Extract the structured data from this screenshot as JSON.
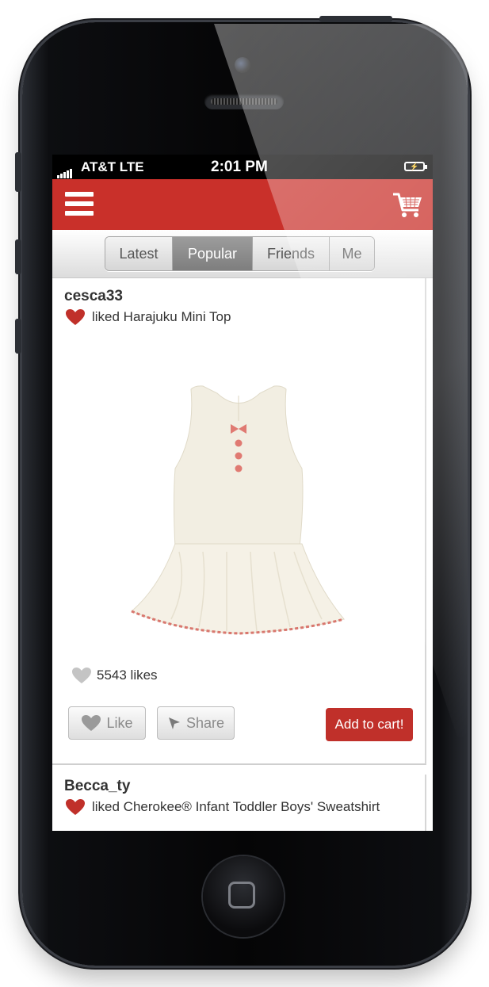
{
  "status_bar": {
    "carrier": "AT&T  LTE",
    "time": "2:01 PM"
  },
  "header": {
    "menu_icon": "hamburger-menu-icon",
    "cart_icon": "shopping-cart-icon",
    "brand_color": "#c9302a"
  },
  "tabs": [
    {
      "label": "Latest",
      "active": false
    },
    {
      "label": "Popular",
      "active": true
    },
    {
      "label": "Friends",
      "active": false
    },
    {
      "label": "Me",
      "active": false
    }
  ],
  "feed": [
    {
      "username": "cesca33",
      "action": "liked Harajuku Mini Top",
      "product_image": "sleeveless-cream-top",
      "likes": "5543 likes",
      "like_label": "Like",
      "share_label": "Share",
      "cart_label": "Add to cart!"
    },
    {
      "username": "Becca_ty",
      "action": "liked Cherokee® Infant Toddler Boys' Sweatshirt"
    }
  ],
  "colors": {
    "accent": "#c0302a",
    "heart": "#c0302a",
    "heart_inactive": "#c4c4c4"
  }
}
